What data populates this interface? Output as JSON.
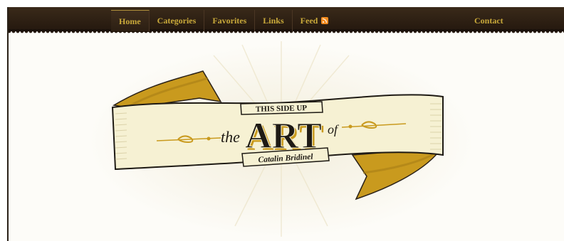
{
  "nav": {
    "items": [
      {
        "label": "Home",
        "active": true
      },
      {
        "label": "Categories",
        "active": false
      },
      {
        "label": "Favorites",
        "active": false
      },
      {
        "label": "Links",
        "active": false
      },
      {
        "label": "Feed",
        "active": false,
        "icon": "rss-icon"
      }
    ],
    "contact_label": "Contact"
  },
  "logo": {
    "tagline": "THIS SIDE UP",
    "prefix": "the",
    "title": "ART",
    "suffix": "of",
    "author": "Catalin Bridinel"
  },
  "colors": {
    "nav_bg": "#24180e",
    "nav_text": "#c9a93a",
    "ribbon_gold": "#c99a1e",
    "ribbon_cream": "#f6f1d3",
    "ink": "#1e1a14",
    "page_bg": "#fdfcf8"
  }
}
